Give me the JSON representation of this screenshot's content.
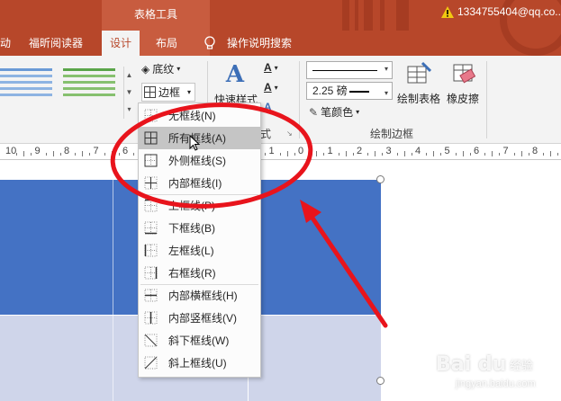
{
  "titlebar": {
    "context_title": "表格工具",
    "account": "1334755404@qq.co...",
    "warning_icon": "warning-icon"
  },
  "tabs": [
    {
      "label": "动"
    },
    {
      "label": "福昕阅读器"
    },
    {
      "label": "设计",
      "active": true
    },
    {
      "label": "布局"
    },
    {
      "label": "操作说明搜索"
    }
  ],
  "ribbon": {
    "shading_label": "底纹",
    "border_label": "边框",
    "quick_styles_label": "快速样式",
    "pen_weight": "2.25 磅",
    "pen_color_label": "笔颜色",
    "draw_table_label": "绘制表格",
    "eraser_label": "橡皮擦",
    "group_draw_border": "绘制边框",
    "group_partial": "式"
  },
  "ruler": {
    "numbers": [
      "10",
      "9",
      "8",
      "7",
      "6",
      "5",
      "4",
      "3",
      "2",
      "1",
      "0",
      "1",
      "2",
      "3",
      "4",
      "5",
      "6",
      "7",
      "8",
      "9",
      "10"
    ]
  },
  "border_menu": {
    "items": [
      {
        "label": "无框线(N)",
        "icon": "no-border-icon"
      },
      {
        "label": "所有框线(A)",
        "icon": "all-borders-icon",
        "selected": true
      },
      {
        "label": "外侧框线(S)",
        "icon": "outside-borders-icon"
      },
      {
        "label": "内部框线(I)",
        "icon": "inside-borders-icon"
      },
      {
        "label": "上框线(P)",
        "icon": "top-border-icon"
      },
      {
        "label": "下框线(B)",
        "icon": "bottom-border-icon"
      },
      {
        "label": "左框线(L)",
        "icon": "left-border-icon"
      },
      {
        "label": "右框线(R)",
        "icon": "right-border-icon"
      },
      {
        "label": "内部横框线(H)",
        "icon": "inside-horizontal-border-icon"
      },
      {
        "label": "内部竖框线(V)",
        "icon": "inside-vertical-border-icon"
      },
      {
        "label": "斜下框线(W)",
        "icon": "diagonal-down-border-icon"
      },
      {
        "label": "斜上框线(U)",
        "icon": "diagonal-up-border-icon"
      }
    ]
  },
  "colors": {
    "accent": "#b7472a",
    "table_header": "#4472c4",
    "table_body": "#cfd5ea",
    "annotation": "#e8141c"
  },
  "watermark": {
    "brand": "Bai du",
    "sub": "经验",
    "url": "jingyan.baidu.com"
  }
}
